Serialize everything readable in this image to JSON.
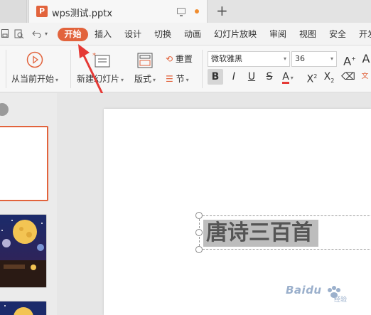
{
  "tab": {
    "title": "wps测试.pptx",
    "logo_letter": "P"
  },
  "menubar": {
    "items": [
      "插入",
      "设计",
      "切换",
      "动画",
      "幻灯片放映",
      "审阅",
      "视图",
      "安全",
      "开发"
    ],
    "active": "开始"
  },
  "ribbon": {
    "play_from_current": "从当前开始",
    "new_slide": "新建幻灯片",
    "layout": "版式",
    "reset": "重置",
    "section": "节",
    "font_name": "微软雅黑",
    "font_size": "36"
  },
  "slide": {
    "title_text": "唐诗三百首"
  },
  "watermark": {
    "text": "Baidu",
    "sub": "经验"
  },
  "colors": {
    "accent": "#e2633c",
    "annotation": "#e53935",
    "underline_red": "#e53935"
  }
}
